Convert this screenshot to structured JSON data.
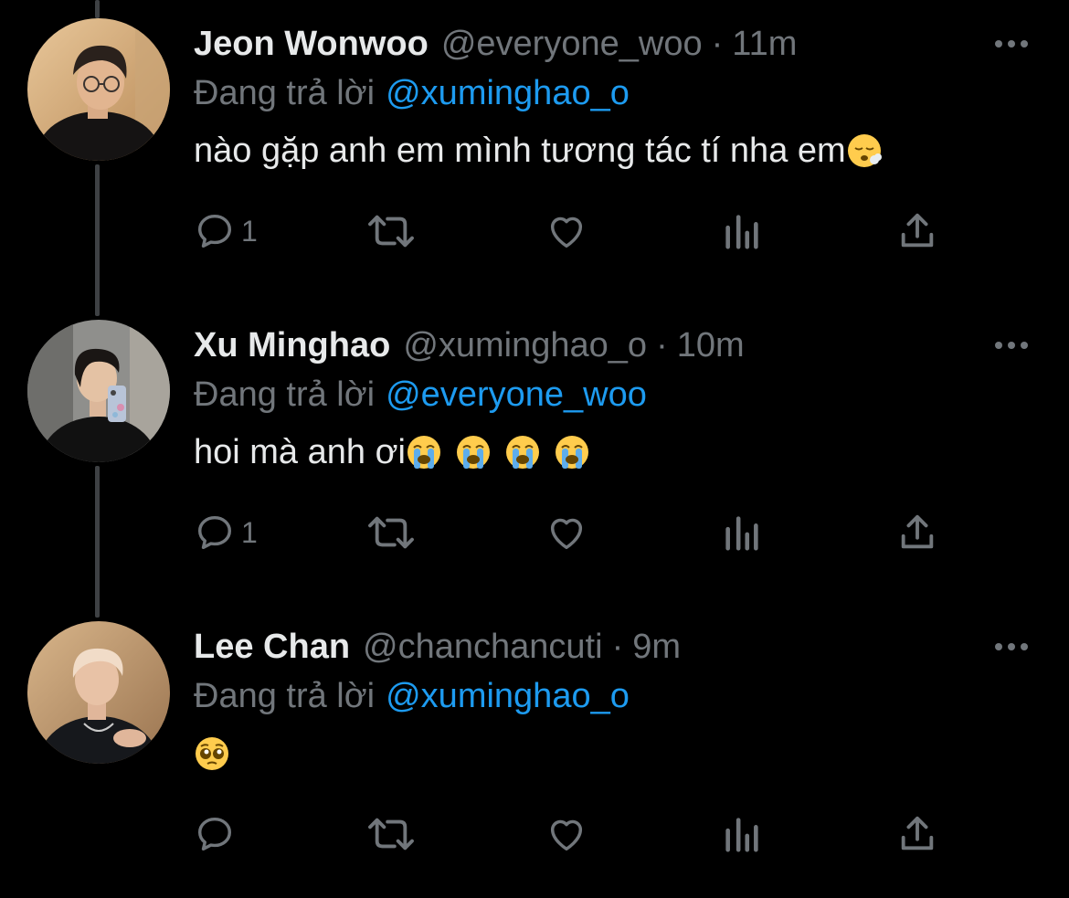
{
  "colors": {
    "background": "#000000",
    "text_primary": "#e7e9ea",
    "text_secondary": "#71767b",
    "link": "#1d9bf0",
    "thread_line": "#3e4144"
  },
  "tweets": [
    {
      "name": "Jeon Wonwoo",
      "handle": "@everyone_woo",
      "separator": "·",
      "time": "11m",
      "reply_prefix": "Đang trả lời",
      "reply_target": "@xuminghao_o",
      "text": "nào gặp anh em mình tương tác tí nha em",
      "emojis": [
        "face-exhaling-emoji"
      ],
      "reply_count": "1"
    },
    {
      "name": "Xu Minghao",
      "handle": "@xuminghao_o",
      "separator": "·",
      "time": "10m",
      "reply_prefix": "Đang trả lời",
      "reply_target": "@everyone_woo",
      "text": "hoi mà anh ơi",
      "emojis": [
        "loudly-crying-emoji",
        "loudly-crying-emoji",
        "loudly-crying-emoji",
        "loudly-crying-emoji"
      ],
      "reply_count": "1"
    },
    {
      "name": "Lee Chan",
      "handle": "@chanchancuti",
      "separator": "·",
      "time": "9m",
      "reply_prefix": "Đang trả lời",
      "reply_target": "@xuminghao_o",
      "text": "",
      "emojis": [
        "pleading-face-emoji"
      ],
      "reply_count": ""
    }
  ],
  "icons": {
    "more": "more-horizontal-icon",
    "reply": "reply-bubble-icon",
    "retweet": "retweet-icon",
    "like": "heart-icon",
    "views": "views-chart-icon",
    "share": "share-upload-icon"
  }
}
